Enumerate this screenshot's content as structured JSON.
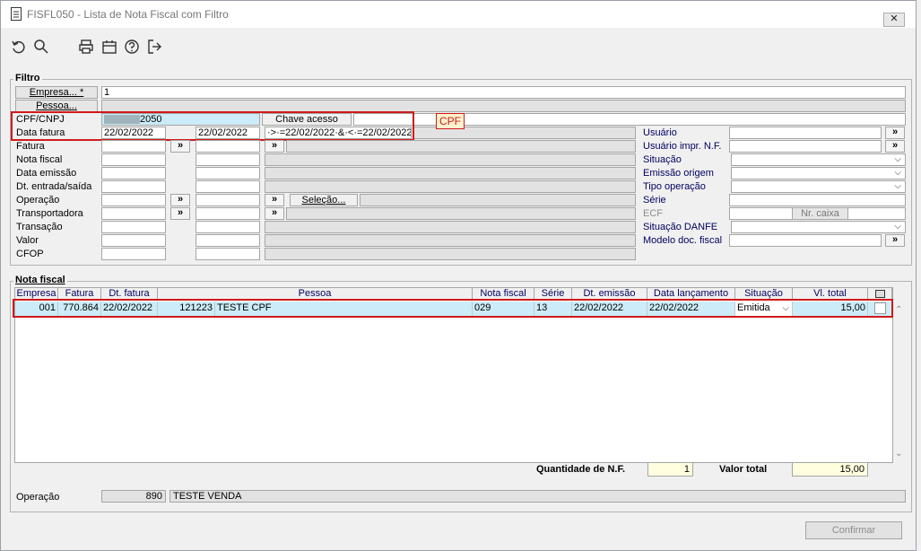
{
  "window": {
    "title": "FISFL050 - Lista de Nota Fiscal com Filtro",
    "close_label": "✕"
  },
  "toolbar": {
    "icons": [
      "refresh-icon",
      "search-icon",
      "print-icon",
      "calendar-icon",
      "help-icon",
      "exit-icon"
    ]
  },
  "filtro": {
    "legend": "Filtro",
    "empresa_btn": "Empresa... *",
    "empresa_value": "1",
    "pessoa_btn": "Pessoa...",
    "cpf_label": "CPF/CNPJ",
    "cpf_value": "2050",
    "chave_btn": "Chave acesso",
    "data_fatura_label": "Data fatura",
    "data_fatura_from": "22/02/2022",
    "data_fatura_to": "22/02/2022",
    "data_fatura_expr": "·>·=22/02/2022·&·<·=22/02/2022",
    "cpf_badge": "CPF",
    "fatura_label": "Fatura",
    "nota_fiscal_label": "Nota fiscal",
    "data_emissao_label": "Data emissão",
    "dt_entrada_label": "Dt. entrada/saída",
    "operacao_label": "Operação",
    "transportadora_label": "Transportadora",
    "transacao_label": "Transação",
    "valor_label": "Valor",
    "cfop_label": "CFOP",
    "selecao_btn": "Seleção...",
    "arrow_btn": "»",
    "usuario_label": "Usuário",
    "usuario_impr_label": "Usuário impr. N.F.",
    "situacao_label": "Situação",
    "emissao_origem_label": "Emissão origem",
    "tipo_operacao_label": "Tipo operação",
    "serie_label": "Série",
    "ecf_label": "ECF",
    "nr_caixa_btn": "Nr. caixa",
    "situacao_danfe_label": "Situação DANFE",
    "modelo_doc_label": "Modelo doc. fiscal"
  },
  "nota_fiscal": {
    "legend": "Nota fiscal",
    "columns": [
      "Empresa",
      "Fatura",
      "Dt. fatura",
      "Pessoa",
      "Nota fiscal",
      "Série",
      "Dt. emissão",
      "Data lançamento",
      "Situação",
      "Vl. total"
    ],
    "rows": [
      {
        "empresa": "001",
        "fatura": "770.864",
        "dt_fatura": "22/02/2022",
        "pessoa_cod": "121223",
        "pessoa_nome": "TESTE CPF",
        "nota_fiscal": "029",
        "serie": "13",
        "dt_emissao": "22/02/2022",
        "data_lancamento": "22/02/2022",
        "situacao": "Emitida",
        "vl_total": "15,00"
      }
    ],
    "quantidade_label": "Quantidade de N.F.",
    "quantidade_value": "1",
    "valor_total_label": "Valor total",
    "valor_total_value": "15,00"
  },
  "footer": {
    "operacao_label": "Operação",
    "operacao_code": "890",
    "operacao_desc": "TESTE VENDA",
    "confirmar_btn": "Confirmar"
  }
}
